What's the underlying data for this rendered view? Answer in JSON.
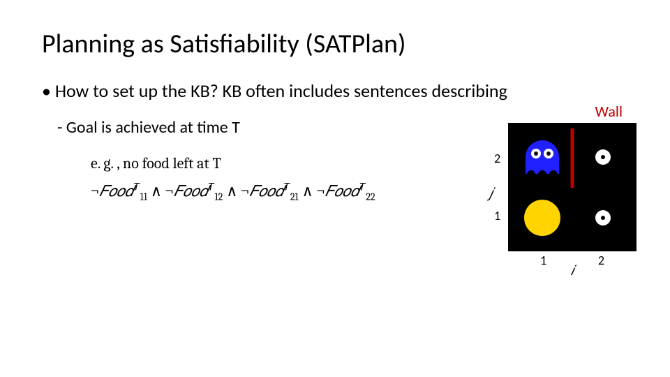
{
  "title": "Planning as Satisfiability (SATPlan)",
  "bullet_main": "How to set up the KB? KB often includes sentences describing",
  "sub_bullet": "Goal is achieved at time T",
  "example_intro": "e. g. , no food left at T",
  "formula_parts": {
    "neg": "¬",
    "food": "𝐹𝑜𝑜𝑑",
    "sub11": "11",
    "sub12": "12",
    "sub21": "21",
    "sub22": "22",
    "supT": "𝑇",
    "and": " ∧ "
  },
  "wall_label": "Wall",
  "axis": {
    "i": "𝑖",
    "j": "𝑗"
  },
  "ticks": {
    "j2": "2",
    "j1": "1",
    "i1": "1",
    "i2": "2"
  },
  "grid": {
    "cells": [
      {
        "pos": "top-left",
        "content": "ghost",
        "name": "ghost-icon"
      },
      {
        "pos": "top-right",
        "content": "pellet",
        "name": "food-pellet-icon"
      },
      {
        "pos": "bottom-left",
        "content": "pacman",
        "name": "pacman-icon"
      },
      {
        "pos": "bottom-right",
        "content": "pellet",
        "name": "food-pellet-icon"
      }
    ],
    "wall_between": "columns-1-2-row-2"
  },
  "chart_data": {
    "type": "table",
    "description": "2x2 PacMan gridworld illustrating SATPlan encoding. i is horizontal axis (columns), j is vertical axis (rows). A wall separates the two top cells between i=1 and i=2 on row j=2.",
    "axes": {
      "x": "i",
      "y": "j"
    },
    "cells": [
      {
        "i": 1,
        "j": 2,
        "object": "Ghost"
      },
      {
        "i": 2,
        "j": 2,
        "object": "Food"
      },
      {
        "i": 1,
        "j": 1,
        "object": "PacMan"
      },
      {
        "i": 2,
        "j": 1,
        "object": "Food"
      }
    ],
    "walls": [
      {
        "between_i": [
          1,
          2
        ],
        "j": 2
      }
    ]
  }
}
